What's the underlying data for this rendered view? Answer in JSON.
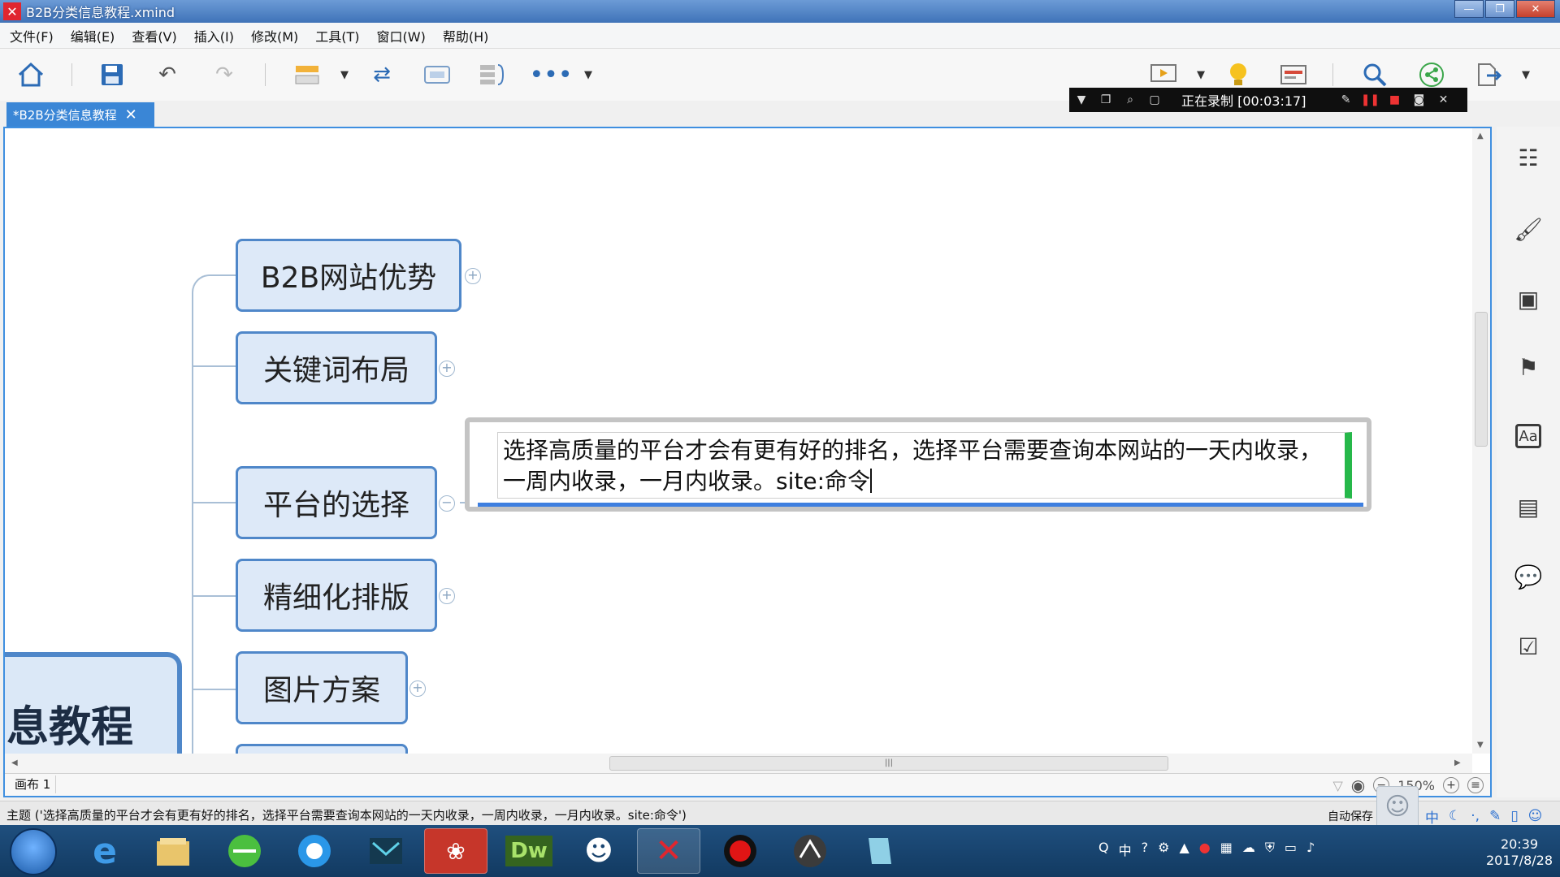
{
  "window": {
    "title": "B2B分类信息教程.xmind",
    "minimize_icon": "minimize-icon",
    "maximize_icon": "maximize-icon",
    "close_icon": "close-icon"
  },
  "menu": [
    "文件(F)",
    "编辑(E)",
    "查看(V)",
    "插入(I)",
    "修改(M)",
    "工具(T)",
    "窗口(W)",
    "帮助(H)"
  ],
  "recording": {
    "label": "正在录制 [00:03:17]"
  },
  "document_tab": {
    "label": "*B2B分类信息教程",
    "close": "✕"
  },
  "mindmap": {
    "central_topic": "息教程",
    "topics": [
      {
        "label": "B2B网站优势",
        "collapsed": true
      },
      {
        "label": "关键词布局",
        "collapsed": true
      },
      {
        "label": "平台的选择",
        "collapsed": false
      },
      {
        "label": "精细化排版",
        "collapsed": true
      },
      {
        "label": "图片方案",
        "collapsed": true
      }
    ],
    "editing_text": "选择高质量的平台才会有更有好的排名，选择平台需要查询本网站的一天内收录，一周内收录，一月内收录。site:命令"
  },
  "canvas_status": {
    "sheet": "画布 1",
    "zoom": "150%"
  },
  "statusbar": {
    "text": "主题 ('选择高质量的平台才会有更有好的排名，选择平台需要查询本网站的一天内收录，一周内收录，一月内收录。site:命令')",
    "autosave": "自动保存"
  },
  "taskbar": {
    "apps": [
      "ie",
      "file-explorer",
      "360-browser",
      "qq-browser",
      "mail",
      "game",
      "Dw",
      "qq",
      "xmind",
      "recorder",
      "media",
      "notes"
    ],
    "dw_label": "Dw",
    "ime": "中",
    "clock_time": "20:39",
    "clock_date": "2017/8/28"
  },
  "colors": {
    "accent": "#3a86d6",
    "node_border": "#4f87c9",
    "node_fill": "#dde9f8",
    "edit_cursor_bar": "#26b84a"
  }
}
